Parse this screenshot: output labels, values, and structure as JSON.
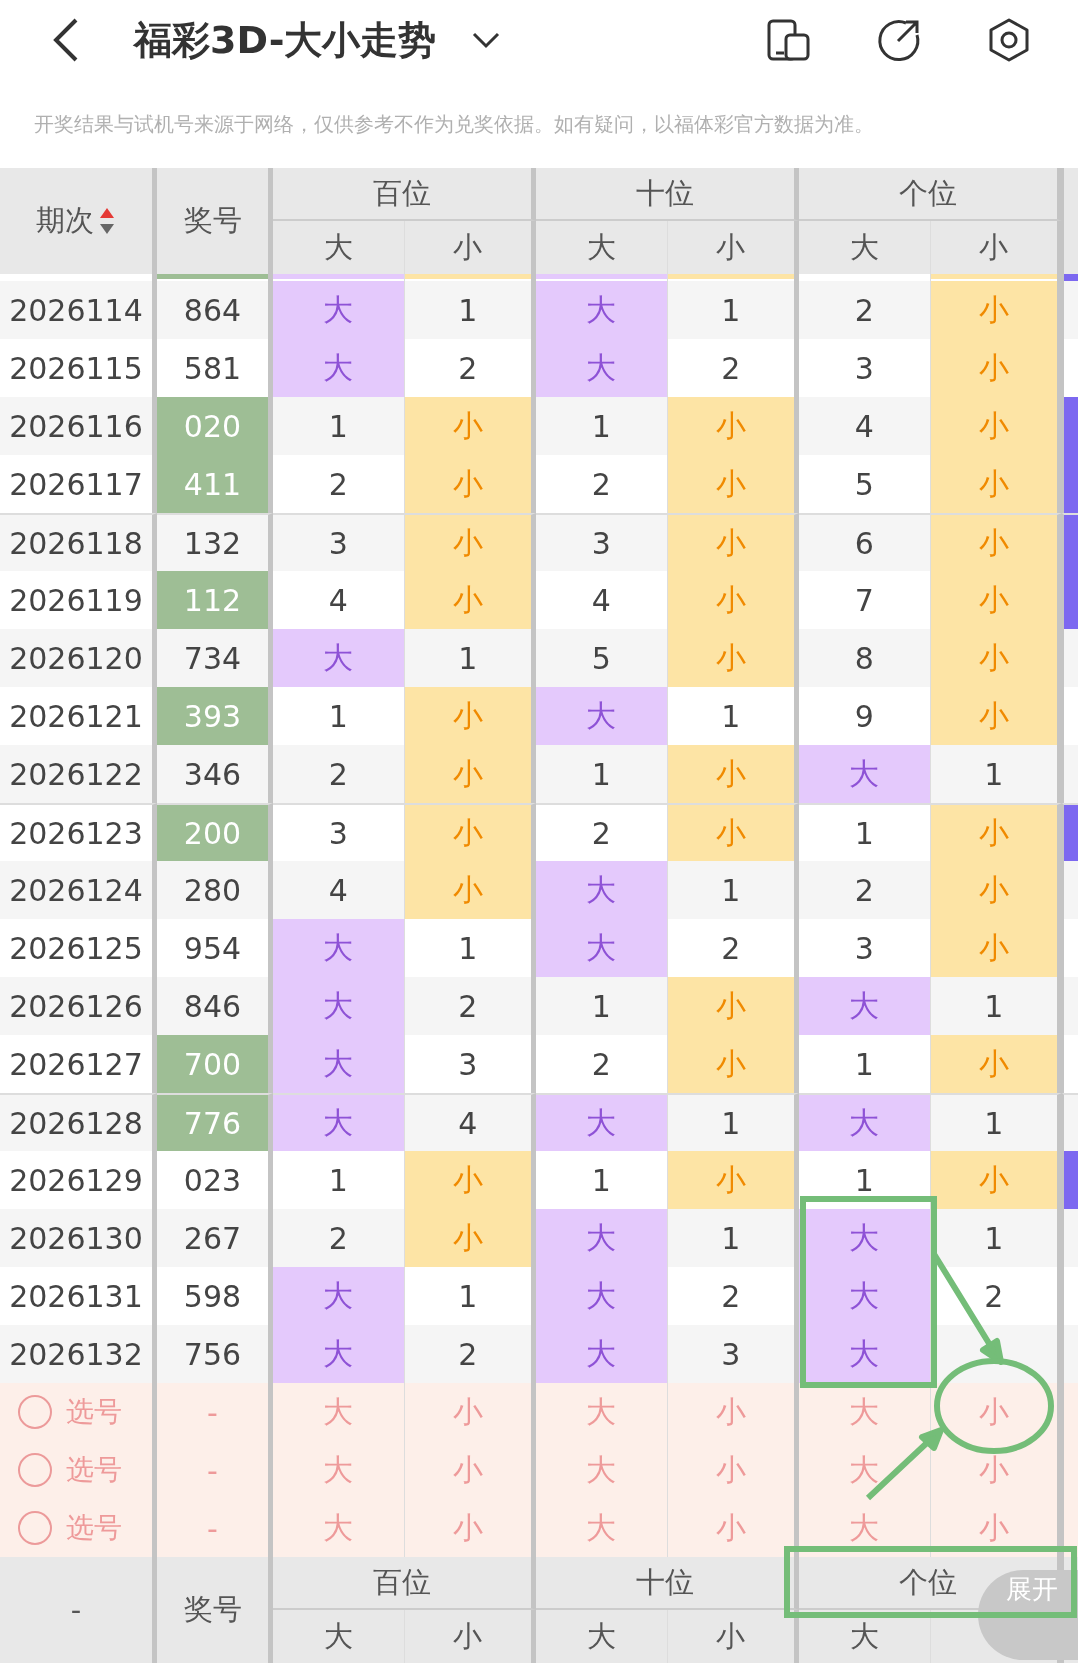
{
  "title_bar": {
    "title": "福彩3D-大小走势"
  },
  "notice": "开奖结果与试机号来源于网络，仅供参考不作为兑奖依据。如有疑问，以福体彩官方数据为准。",
  "table": {
    "header": {
      "issue_label": "期次",
      "sorted_ascending": true,
      "number_label": "奖号",
      "groups": [
        {
          "label": "百位",
          "sub": [
            "大",
            "小"
          ]
        },
        {
          "label": "十位",
          "sub": [
            "大",
            "小"
          ]
        },
        {
          "label": "个位",
          "sub": [
            "大",
            "小"
          ]
        }
      ]
    },
    "top_strip": {
      "number_green": true,
      "hits": [
        true,
        true,
        true,
        true,
        false,
        true
      ],
      "edge_mark": true
    },
    "rows": [
      {
        "issue": "2026114",
        "number": "864",
        "green": false,
        "edge_mark": false,
        "cells": [
          {
            "text": "大",
            "hit": true
          },
          {
            "text": "1",
            "hit": false
          },
          {
            "text": "大",
            "hit": true
          },
          {
            "text": "1",
            "hit": false
          },
          {
            "text": "2",
            "hit": false
          },
          {
            "text": "小",
            "hit": true
          }
        ]
      },
      {
        "issue": "2026115",
        "number": "581",
        "green": false,
        "edge_mark": false,
        "cells": [
          {
            "text": "大",
            "hit": true
          },
          {
            "text": "2",
            "hit": false
          },
          {
            "text": "大",
            "hit": true
          },
          {
            "text": "2",
            "hit": false
          },
          {
            "text": "3",
            "hit": false
          },
          {
            "text": "小",
            "hit": true
          }
        ]
      },
      {
        "issue": "2026116",
        "number": "020",
        "green": true,
        "edge_mark": true,
        "cells": [
          {
            "text": "1",
            "hit": false
          },
          {
            "text": "小",
            "hit": true
          },
          {
            "text": "1",
            "hit": false
          },
          {
            "text": "小",
            "hit": true
          },
          {
            "text": "4",
            "hit": false
          },
          {
            "text": "小",
            "hit": true
          }
        ]
      },
      {
        "issue": "2026117",
        "number": "411",
        "green": true,
        "edge_mark": true,
        "cells": [
          {
            "text": "2",
            "hit": false
          },
          {
            "text": "小",
            "hit": true
          },
          {
            "text": "2",
            "hit": false
          },
          {
            "text": "小",
            "hit": true
          },
          {
            "text": "5",
            "hit": false
          },
          {
            "text": "小",
            "hit": true
          }
        ]
      },
      {
        "issue": "2026118",
        "number": "132",
        "green": false,
        "edge_mark": true,
        "cells": [
          {
            "text": "3",
            "hit": false
          },
          {
            "text": "小",
            "hit": true
          },
          {
            "text": "3",
            "hit": false
          },
          {
            "text": "小",
            "hit": true
          },
          {
            "text": "6",
            "hit": false
          },
          {
            "text": "小",
            "hit": true
          }
        ]
      },
      {
        "issue": "2026119",
        "number": "112",
        "green": true,
        "edge_mark": true,
        "cells": [
          {
            "text": "4",
            "hit": false
          },
          {
            "text": "小",
            "hit": true
          },
          {
            "text": "4",
            "hit": false
          },
          {
            "text": "小",
            "hit": true
          },
          {
            "text": "7",
            "hit": false
          },
          {
            "text": "小",
            "hit": true
          }
        ]
      },
      {
        "issue": "2026120",
        "number": "734",
        "green": false,
        "edge_mark": false,
        "cells": [
          {
            "text": "大",
            "hit": true
          },
          {
            "text": "1",
            "hit": false
          },
          {
            "text": "5",
            "hit": false
          },
          {
            "text": "小",
            "hit": true
          },
          {
            "text": "8",
            "hit": false
          },
          {
            "text": "小",
            "hit": true
          }
        ]
      },
      {
        "issue": "2026121",
        "number": "393",
        "green": true,
        "edge_mark": false,
        "cells": [
          {
            "text": "1",
            "hit": false
          },
          {
            "text": "小",
            "hit": true
          },
          {
            "text": "大",
            "hit": true
          },
          {
            "text": "1",
            "hit": false
          },
          {
            "text": "9",
            "hit": false
          },
          {
            "text": "小",
            "hit": true
          }
        ]
      },
      {
        "issue": "2026122",
        "number": "346",
        "green": false,
        "edge_mark": false,
        "cells": [
          {
            "text": "2",
            "hit": false
          },
          {
            "text": "小",
            "hit": true
          },
          {
            "text": "1",
            "hit": false
          },
          {
            "text": "小",
            "hit": true
          },
          {
            "text": "大",
            "hit": true
          },
          {
            "text": "1",
            "hit": false
          }
        ]
      },
      {
        "issue": "2026123",
        "number": "200",
        "green": true,
        "edge_mark": true,
        "cells": [
          {
            "text": "3",
            "hit": false
          },
          {
            "text": "小",
            "hit": true
          },
          {
            "text": "2",
            "hit": false
          },
          {
            "text": "小",
            "hit": true
          },
          {
            "text": "1",
            "hit": false
          },
          {
            "text": "小",
            "hit": true
          }
        ]
      },
      {
        "issue": "2026124",
        "number": "280",
        "green": false,
        "edge_mark": false,
        "cells": [
          {
            "text": "4",
            "hit": false
          },
          {
            "text": "小",
            "hit": true
          },
          {
            "text": "大",
            "hit": true
          },
          {
            "text": "1",
            "hit": false
          },
          {
            "text": "2",
            "hit": false
          },
          {
            "text": "小",
            "hit": true
          }
        ]
      },
      {
        "issue": "2026125",
        "number": "954",
        "green": false,
        "edge_mark": false,
        "cells": [
          {
            "text": "大",
            "hit": true
          },
          {
            "text": "1",
            "hit": false
          },
          {
            "text": "大",
            "hit": true
          },
          {
            "text": "2",
            "hit": false
          },
          {
            "text": "3",
            "hit": false
          },
          {
            "text": "小",
            "hit": true
          }
        ]
      },
      {
        "issue": "2026126",
        "number": "846",
        "green": false,
        "edge_mark": false,
        "cells": [
          {
            "text": "大",
            "hit": true
          },
          {
            "text": "2",
            "hit": false
          },
          {
            "text": "1",
            "hit": false
          },
          {
            "text": "小",
            "hit": true
          },
          {
            "text": "大",
            "hit": true
          },
          {
            "text": "1",
            "hit": false
          }
        ]
      },
      {
        "issue": "2026127",
        "number": "700",
        "green": true,
        "edge_mark": false,
        "cells": [
          {
            "text": "大",
            "hit": true
          },
          {
            "text": "3",
            "hit": false
          },
          {
            "text": "2",
            "hit": false
          },
          {
            "text": "小",
            "hit": true
          },
          {
            "text": "1",
            "hit": false
          },
          {
            "text": "小",
            "hit": true
          }
        ]
      },
      {
        "issue": "2026128",
        "number": "776",
        "green": true,
        "edge_mark": false,
        "cells": [
          {
            "text": "大",
            "hit": true
          },
          {
            "text": "4",
            "hit": false
          },
          {
            "text": "大",
            "hit": true
          },
          {
            "text": "1",
            "hit": false
          },
          {
            "text": "大",
            "hit": true
          },
          {
            "text": "1",
            "hit": false
          }
        ]
      },
      {
        "issue": "2026129",
        "number": "023",
        "green": false,
        "edge_mark": true,
        "cells": [
          {
            "text": "1",
            "hit": false
          },
          {
            "text": "小",
            "hit": true
          },
          {
            "text": "1",
            "hit": false
          },
          {
            "text": "小",
            "hit": true
          },
          {
            "text": "1",
            "hit": false
          },
          {
            "text": "小",
            "hit": true
          }
        ]
      },
      {
        "issue": "2026130",
        "number": "267",
        "green": false,
        "edge_mark": false,
        "cells": [
          {
            "text": "2",
            "hit": false
          },
          {
            "text": "小",
            "hit": true
          },
          {
            "text": "大",
            "hit": true
          },
          {
            "text": "1",
            "hit": false
          },
          {
            "text": "大",
            "hit": true
          },
          {
            "text": "1",
            "hit": false
          }
        ]
      },
      {
        "issue": "2026131",
        "number": "598",
        "green": false,
        "edge_mark": false,
        "cells": [
          {
            "text": "大",
            "hit": true
          },
          {
            "text": "1",
            "hit": false
          },
          {
            "text": "大",
            "hit": true
          },
          {
            "text": "2",
            "hit": false
          },
          {
            "text": "大",
            "hit": true
          },
          {
            "text": "2",
            "hit": false
          }
        ]
      },
      {
        "issue": "2026132",
        "number": "756",
        "green": false,
        "edge_mark": false,
        "cells": [
          {
            "text": "大",
            "hit": true
          },
          {
            "text": "2",
            "hit": false
          },
          {
            "text": "大",
            "hit": true
          },
          {
            "text": "3",
            "hit": false
          },
          {
            "text": "大",
            "hit": true
          },
          {
            "hit": false
          }
        ]
      }
    ],
    "pick_rows": [
      {
        "label": "选号",
        "checked": false,
        "number": "-",
        "cells": [
          "大",
          "小",
          "大",
          "小",
          "大",
          "小"
        ]
      },
      {
        "label": "选号",
        "checked": false,
        "number": "-",
        "cells": [
          "大",
          "小",
          "大",
          "小",
          "大",
          "小"
        ]
      },
      {
        "label": "选号",
        "checked": false,
        "number": "-",
        "cells": [
          "大",
          "小",
          "大",
          "小",
          "大",
          "小"
        ]
      }
    ],
    "footer": {
      "issue_label": "-",
      "number_label": "奖号",
      "groups": [
        {
          "label": "百位",
          "sub": [
            "大",
            "小"
          ]
        },
        {
          "label": "十位",
          "sub": [
            "大",
            "小"
          ]
        },
        {
          "label": "个位",
          "sub": [
            "大"
          ]
        }
      ]
    }
  },
  "expand_button": {
    "label": "展开"
  }
}
